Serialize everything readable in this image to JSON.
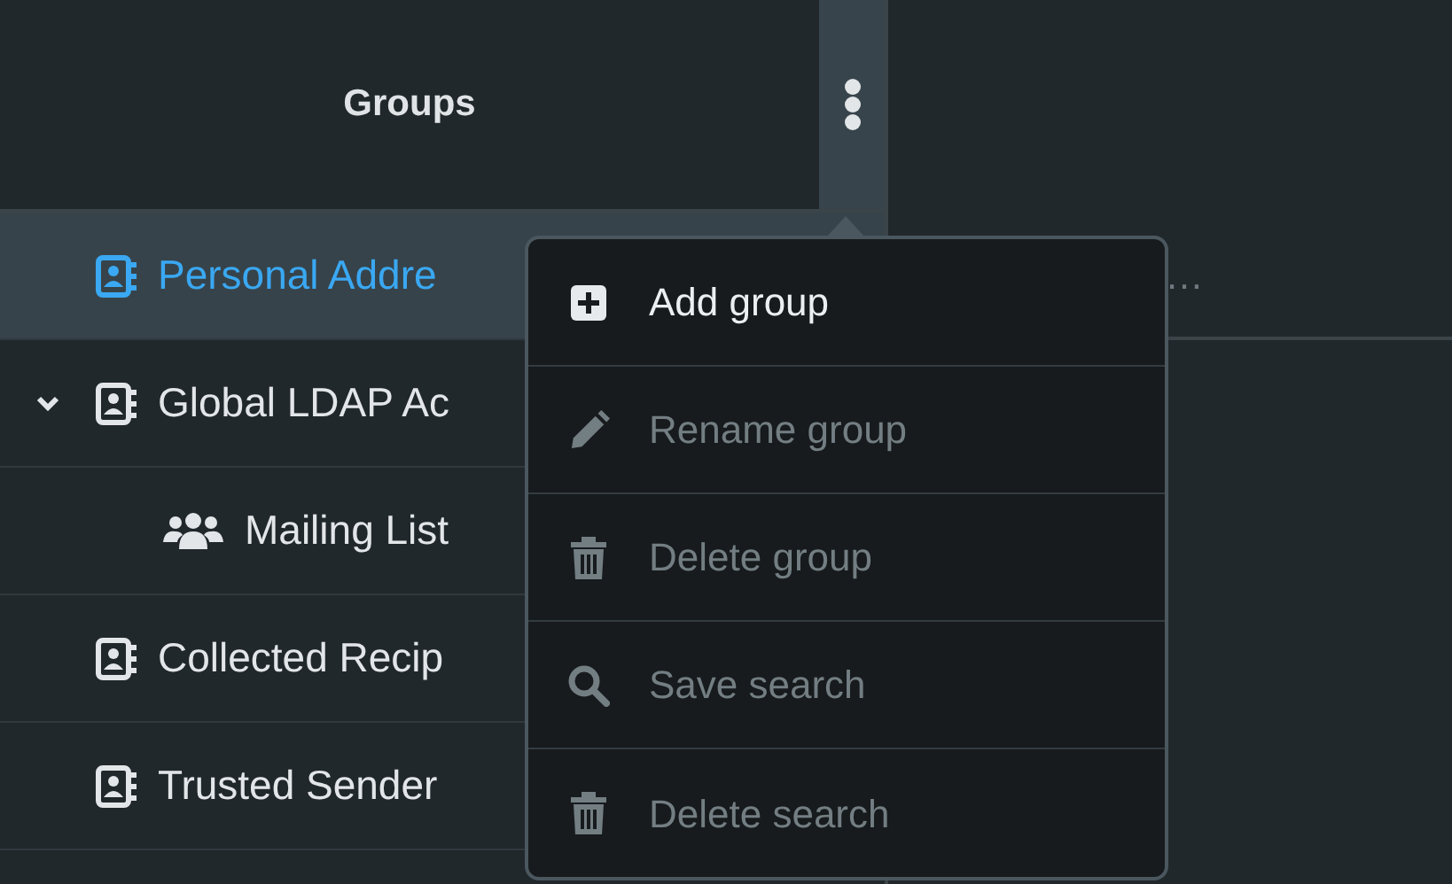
{
  "groups_panel": {
    "title": "Groups",
    "items": [
      {
        "label": "Personal Addre",
        "kind": "addressbook",
        "selected": true
      },
      {
        "label": "Global LDAP Ac",
        "kind": "addressbook",
        "selected": false,
        "expanded": true,
        "children": [
          {
            "label": "Mailing List",
            "kind": "list",
            "selected": false
          }
        ]
      },
      {
        "label": "Collected Recip",
        "kind": "addressbook",
        "selected": false
      },
      {
        "label": "Trusted Sender",
        "kind": "addressbook",
        "selected": false
      }
    ]
  },
  "contacts_panel": {
    "rows": [
      {
        "text": "…"
      }
    ]
  },
  "popup_menu": {
    "items": [
      {
        "label": "Add group",
        "kind": "plus",
        "disabled": false
      },
      {
        "label": "Rename group",
        "kind": "pencil",
        "disabled": true
      },
      {
        "label": "Delete group",
        "kind": "trash",
        "disabled": true
      },
      {
        "label": "Save search",
        "kind": "search",
        "disabled": true
      },
      {
        "label": "Delete search",
        "kind": "trash",
        "disabled": true
      }
    ]
  }
}
